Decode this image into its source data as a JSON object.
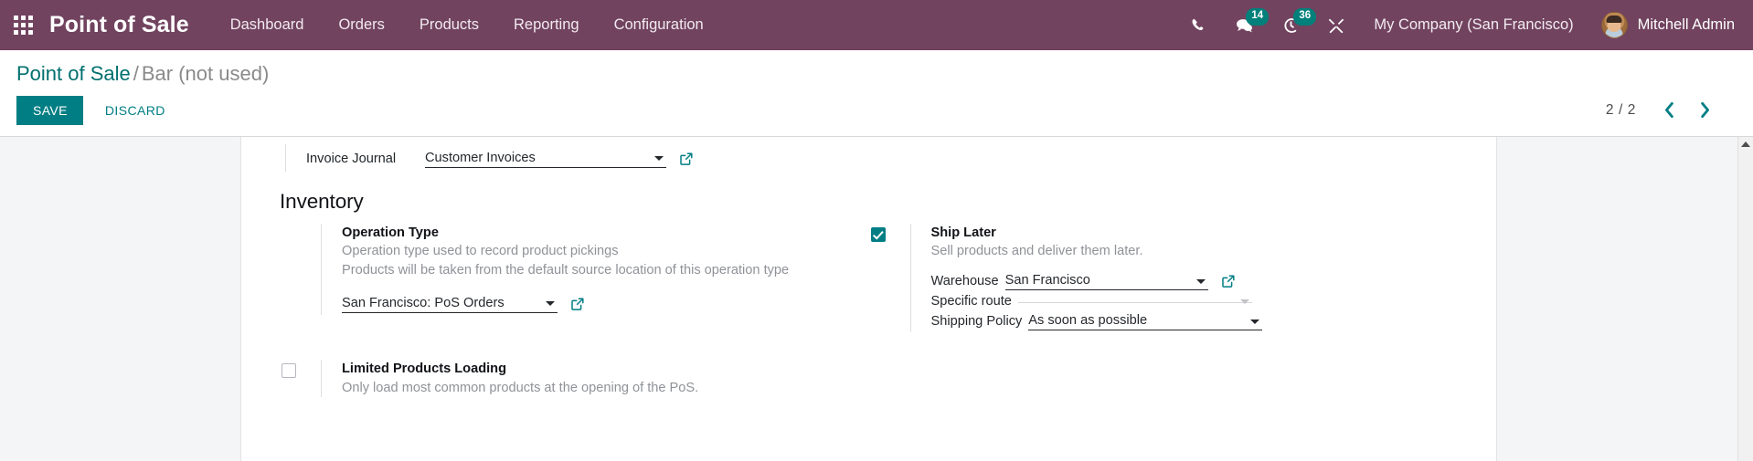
{
  "navbar": {
    "apps_icon": "apps-grid-icon",
    "brand": "Point of Sale",
    "menu": [
      {
        "label": "Dashboard"
      },
      {
        "label": "Orders"
      },
      {
        "label": "Products"
      },
      {
        "label": "Reporting"
      },
      {
        "label": "Configuration"
      }
    ],
    "sys_icons": [
      {
        "name": "phone-icon",
        "badge": ""
      },
      {
        "name": "messages-icon",
        "badge": "14"
      },
      {
        "name": "activities-clock-icon",
        "badge": "36"
      },
      {
        "name": "developer-tools-icon",
        "badge": ""
      }
    ],
    "messages_badge": "14",
    "activities_badge": "36",
    "company": "My Company (San Francisco)",
    "user": "Mitchell Admin"
  },
  "control_panel": {
    "breadcrumb_root": "Point of Sale",
    "breadcrumb_sep": "/",
    "breadcrumb_current": "Bar (not used)",
    "save_label": "SAVE",
    "discard_label": "DISCARD",
    "pager_count": "2 / 2",
    "pager_prev_icon": "chevron-left-icon",
    "pager_next_icon": "chevron-right-icon"
  },
  "form": {
    "invoice_journal": {
      "label": "Invoice Journal",
      "value": "Customer Invoices"
    },
    "inventory_section": "Inventory",
    "operation_type": {
      "checked": false,
      "title": "Operation Type",
      "desc_line1": "Operation type used to record product pickings",
      "desc_line2": "Products will be taken from the default source location of this operation type",
      "value": "San Francisco: PoS Orders"
    },
    "ship_later": {
      "checked": true,
      "title": "Ship Later",
      "desc": "Sell products and deliver them later.",
      "warehouse_label": "Warehouse",
      "warehouse_value": "San Francisco",
      "specific_route_label": "Specific route",
      "specific_route_value": "",
      "shipping_policy_label": "Shipping Policy",
      "shipping_policy_value": "As soon as possible"
    },
    "limited_products": {
      "checked": false,
      "title": "Limited Products Loading",
      "desc": "Only load most common products at the opening of the PoS."
    }
  },
  "colors": {
    "navbar_bg": "#71435f",
    "accent_teal": "#017e84",
    "badge_teal": "#00807b",
    "body_bg": "#f4f5f7",
    "muted_text": "#8f9297"
  },
  "scrollbar": {
    "up_arrow_icon": "scroll-up-arrow-icon"
  }
}
